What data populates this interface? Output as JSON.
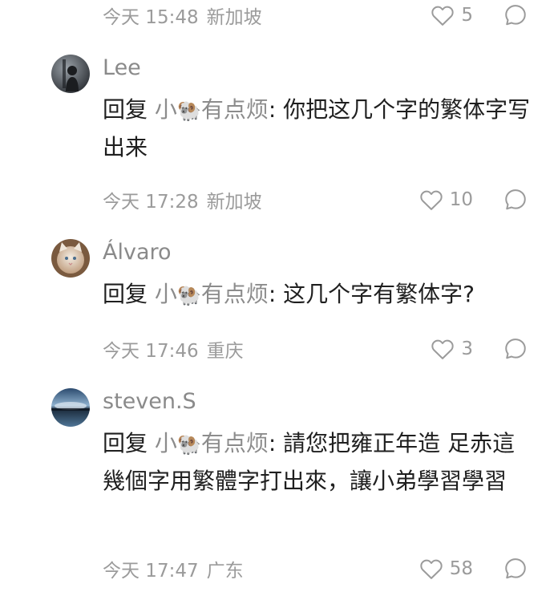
{
  "top_meta": {
    "time": "今天 15:48",
    "location": "新加坡",
    "likes": "5"
  },
  "comments": [
    {
      "username": "Lee",
      "reply_prefix": "回复",
      "mention_name": "小",
      "mention_emoji": "🐏",
      "mention_suffix": "有点烦",
      "text": ": 你把这几个字的繁体字写出来",
      "time": "今天 17:28",
      "location": "新加坡",
      "likes": "10"
    },
    {
      "username": "Álvaro",
      "reply_prefix": "回复",
      "mention_name": "小",
      "mention_emoji": "🐏",
      "mention_suffix": "有点烦",
      "text": ": 这几个字有繁体字?",
      "time": "今天 17:46",
      "location": "重庆",
      "likes": "3"
    },
    {
      "username": "steven.S",
      "reply_prefix": "回复",
      "mention_name": "小",
      "mention_emoji": "🐏",
      "mention_suffix": "有点烦",
      "text": ": 請您把雍正年造 足赤這幾個字用繁體字打出來，讓小弟學習學習",
      "time": "今天 17:47",
      "location": "广东",
      "likes": "58"
    }
  ],
  "icons": {
    "like": "heart-outline-icon",
    "reply": "speech-bubble-icon"
  },
  "colors": {
    "meta_text": "#9b9b9b",
    "username": "#8a8a8a",
    "body_text": "#1f1f1f"
  }
}
